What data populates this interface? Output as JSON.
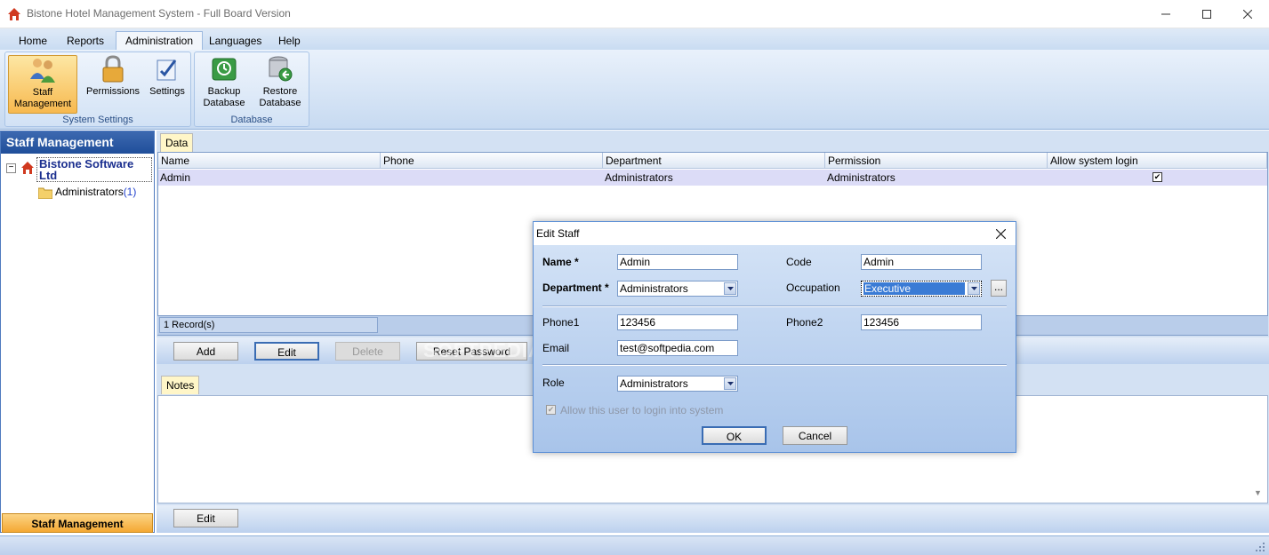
{
  "window": {
    "title": "Bistone Hotel Management System - Full Board Version"
  },
  "menu": [
    "Home",
    "Reports",
    "Administration",
    "Languages",
    "Help"
  ],
  "ribbon": {
    "groups": [
      {
        "label": "System Settings",
        "buttons": [
          {
            "line1": "Staff",
            "line2": "Management",
            "icon": "staff-icon"
          },
          {
            "line1": "Permissions",
            "line2": "",
            "icon": "lock-icon"
          },
          {
            "line1": "Settings",
            "line2": "",
            "icon": "settings-icon"
          }
        ]
      },
      {
        "label": "Database",
        "buttons": [
          {
            "line1": "Backup",
            "line2": "Database",
            "icon": "backup-icon"
          },
          {
            "line1": "Restore",
            "line2": "Database",
            "icon": "restore-icon"
          }
        ]
      }
    ]
  },
  "left_panel": {
    "title": "Staff Management",
    "tree_root": "Bistone Software Ltd",
    "tree_root_line1": "Bistone Software",
    "tree_root_line2": "Ltd",
    "tree_child": "Administrators",
    "tree_child_count": "(1)",
    "footer": "Staff Management"
  },
  "data_tab": "Data",
  "grid": {
    "columns": [
      "Name",
      "Phone",
      "Department",
      "Permission",
      "Allow system login"
    ],
    "rows": [
      {
        "name": "Admin",
        "phone": "",
        "department": "Administrators",
        "permission": "Administrators",
        "allow_login": true
      }
    ],
    "records": "1 Record(s)"
  },
  "actions": {
    "add": "Add",
    "edit": "Edit",
    "delete": "Delete",
    "reset_password": "Reset Password"
  },
  "watermark": "SOFTPEDIA",
  "notes_tab": "Notes",
  "bottom_edit": "Edit",
  "dialog": {
    "title": "Edit Staff",
    "name_label": "Name *",
    "name_value": "Admin",
    "code_label": "Code",
    "code_value": "Admin",
    "department_label": "Department *",
    "department_value": "Administrators",
    "occupation_label": "Occupation",
    "occupation_value": "Executive",
    "more_button": "...",
    "phone1_label": "Phone1",
    "phone1_value": "123456",
    "phone2_label": "Phone2",
    "phone2_value": "123456",
    "email_label": "Email",
    "email_value": "test@softpedia.com",
    "role_label": "Role",
    "role_value": "Administrators",
    "allow_login_label": "Allow this user to login into system",
    "ok": "OK",
    "cancel": "Cancel"
  },
  "colors": {
    "accent": "#1f4e9a",
    "selection": "#3a7bd5",
    "row_highlight": "#dcdcf7",
    "orange": "#f4a834"
  }
}
